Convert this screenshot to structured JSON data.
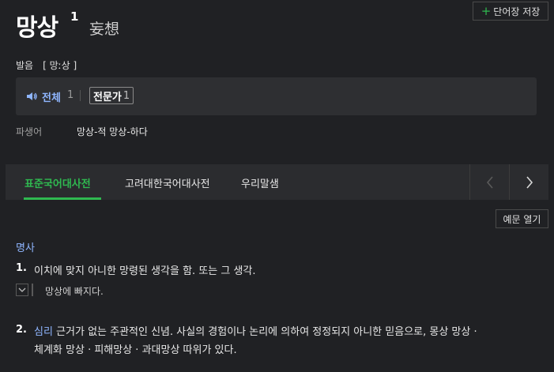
{
  "header": {
    "headword": "망상",
    "superscript": "1",
    "hanja": "妄想",
    "save_button": {
      "plus": "+",
      "label": "단어장 저장"
    }
  },
  "pronunciation": {
    "label": "발음",
    "value": "[ 망ː상 ]"
  },
  "audio": {
    "all_label": "전체",
    "all_count": "1",
    "expert_label": "전문가",
    "expert_count": "1"
  },
  "derived": {
    "label": "파생어",
    "value": "망상-적  망상-하다"
  },
  "tabs": [
    {
      "label": "표준국어대사전",
      "active": true
    },
    {
      "label": "고려대한국어대사전",
      "active": false
    },
    {
      "label": "우리말샘",
      "active": false
    }
  ],
  "example_toggle_label": "예문 열기",
  "definitions": {
    "part_of_speech": "명사",
    "items": [
      {
        "number": "1.",
        "text": "이치에 맞지 아니한 망령된 생각을 함. 또는 그 생각.",
        "example": "망상에 빠지다."
      },
      {
        "number": "2.",
        "tag": "심리",
        "text_line1": " 근거가 없는 주관적인 신념. 사실의 경험이나 논리에 의하여 정정되지 아니한 믿음으로, 몽상 망상 ·",
        "text_line2": "체계화 망상 · 피해망상 · 과대망상 따위가 있다."
      }
    ]
  },
  "colors": {
    "background": "#202124",
    "accent_green": "#2fb950",
    "link_blue": "#8fb6ff"
  },
  "icons": [
    "plus-icon",
    "speaker-icon",
    "chevron-left-icon",
    "chevron-right-icon",
    "chevron-down-icon"
  ]
}
